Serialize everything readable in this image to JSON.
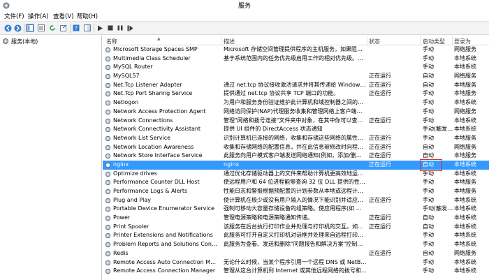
{
  "window": {
    "title": "服务"
  },
  "menu": [
    "文件(F)",
    "操作(A)",
    "查看(V)",
    "帮助(H)"
  ],
  "toolbar": {
    "icons": [
      "back-arrow-icon",
      "forward-arrow-icon",
      "console-tree-icon",
      "properties-icon",
      "refresh-icon",
      "export-icon",
      "help-icon",
      "show-hide-icon",
      "play-icon",
      "stop-icon",
      "pause-icon",
      "restart-icon"
    ]
  },
  "tree": {
    "root_label": "服务(本地)"
  },
  "columns": {
    "name": "名称",
    "desc": "描述",
    "status": "状态",
    "startup": "启动类型",
    "logon": "登录为"
  },
  "services": [
    {
      "name": "Microsoft Storage Spaces SMP",
      "desc": "Microsoft 存储空间管理提供程序的主机服务。如果阻止…",
      "status": "",
      "startup": "手动",
      "logon": "网络服务"
    },
    {
      "name": "Multimedia Class Scheduler",
      "desc": "基于系统范围内的任务优先级启用工作的相对优先级。这主…",
      "status": "",
      "startup": "手动",
      "logon": "本地系统"
    },
    {
      "name": "MySQL Router",
      "desc": "",
      "status": "",
      "startup": "手动",
      "logon": "本地系统"
    },
    {
      "name": "MySQL57",
      "desc": "",
      "status": "正在运行",
      "startup": "自动",
      "logon": "网络服务"
    },
    {
      "name": "Net.Tcp Listener Adapter",
      "desc": "通过 net.tcp 协议接收激活请求并将其传递给 Windows 进…",
      "status": "正在运行",
      "startup": "自动",
      "logon": "本地服务"
    },
    {
      "name": "Net.Tcp Port Sharing Service",
      "desc": "提供通过 net.tcp 协议共享 TCP 端口的功能。",
      "status": "正在运行",
      "startup": "手动",
      "logon": "本地服务"
    },
    {
      "name": "Netlogon",
      "desc": "为用户和服务身份验证维护此计算机和域控制器之间的安全…",
      "status": "",
      "startup": "手动",
      "logon": "本地系统"
    },
    {
      "name": "Network Access Protection Agent",
      "desc": "网络访问保护(NAP)代理服务收集和管理网络上客户端计算机…",
      "status": "",
      "startup": "手动",
      "logon": "网络服务"
    },
    {
      "name": "Network Connections",
      "desc": "管理\"网络和拨号连接\"文件夹中对象，在其中你可以查看局…",
      "status": "正在运行",
      "startup": "手动",
      "logon": "本地系统"
    },
    {
      "name": "Network Connectivity Assistant",
      "desc": "提供 UI 组件的 DirectAccess 状态通知",
      "status": "",
      "startup": "手动(触发…",
      "logon": "本地系统"
    },
    {
      "name": "Network List Service",
      "desc": "识别计算机已连接的网络，收集和存储这些网络的属性，并…",
      "status": "正在运行",
      "startup": "手动",
      "logon": "本地服务"
    },
    {
      "name": "Network Location Awareness",
      "desc": "收集和存储网络的配置信息，并在此信息被修改时向程序发…",
      "status": "正在运行",
      "startup": "自动",
      "logon": "网络服务"
    },
    {
      "name": "Network Store Interface Service",
      "desc": "此服务向用户模式客户端发送网络通知(例如，添加/删除接…",
      "status": "正在运行",
      "startup": "自动",
      "logon": "本地服务"
    },
    {
      "name": "nginx",
      "desc": "nginx",
      "status": "正在运行",
      "startup": "自动",
      "logon": "本地系统",
      "selected": true
    },
    {
      "name": "Optimize drives",
      "desc": "通过优化存储驱动器上的文件来帮助计算机更高效地运行。",
      "status": "",
      "startup": "手动",
      "logon": "本地系统"
    },
    {
      "name": "Performance Counter DLL Host",
      "desc": "使远程用户和 64 位进程能够查询 32 位 DLL 提供的性能计…",
      "status": "",
      "startup": "手动",
      "logon": "本地服务"
    },
    {
      "name": "Performance Logs & Alerts",
      "desc": "性能日志和警报根据预配置的计划参数从本地或远程计算机…",
      "status": "",
      "startup": "手动",
      "logon": "本地服务"
    },
    {
      "name": "Plug and Play",
      "desc": "使计算机在极少或没有用户输入的情况下能识别并适应硬件…",
      "status": "正在运行",
      "startup": "手动",
      "logon": "本地系统"
    },
    {
      "name": "Portable Device Enumerator Service",
      "desc": "强制可移动大容量存储设备的组策略。使应用程序(如 Windo…",
      "status": "",
      "startup": "手动(触发…",
      "logon": "本地系统"
    },
    {
      "name": "Power",
      "desc": "管理电源策略和电源策略通知传递。",
      "status": "正在运行",
      "startup": "自动",
      "logon": "本地系统"
    },
    {
      "name": "Print Spooler",
      "desc": "该服务在后台执行打印作业并处理与打印机的交互。如果关…",
      "status": "正在运行",
      "startup": "自动",
      "logon": "本地系统"
    },
    {
      "name": "Printer Extensions and Notifications",
      "desc": "此服务可打开自定义打印机对话框并处理来自远程打印服务…",
      "status": "",
      "startup": "手动",
      "logon": "本地系统"
    },
    {
      "name": "Problem Reports and Solutions Control P…",
      "desc": "此服务为查看、发送和删除\"问题报告和解决方案\"控制面板的…",
      "status": "",
      "startup": "手动",
      "logon": "本地系统"
    },
    {
      "name": "Redis",
      "desc": "",
      "status": "正在运行",
      "startup": "自动",
      "logon": "网络服务"
    },
    {
      "name": "Remote Access Auto Connection Manager",
      "desc": "无论什么时候，当某个程序引用一个远程 DNS 或 NetBIO…",
      "status": "",
      "startup": "手动",
      "logon": "本地系统"
    },
    {
      "name": "Remote Access Connection Manager",
      "desc": "管理从这台计算机到 Internet 或其他远程网络的拨号和虚…",
      "status": "",
      "startup": "手动",
      "logon": "本地系统"
    }
  ]
}
